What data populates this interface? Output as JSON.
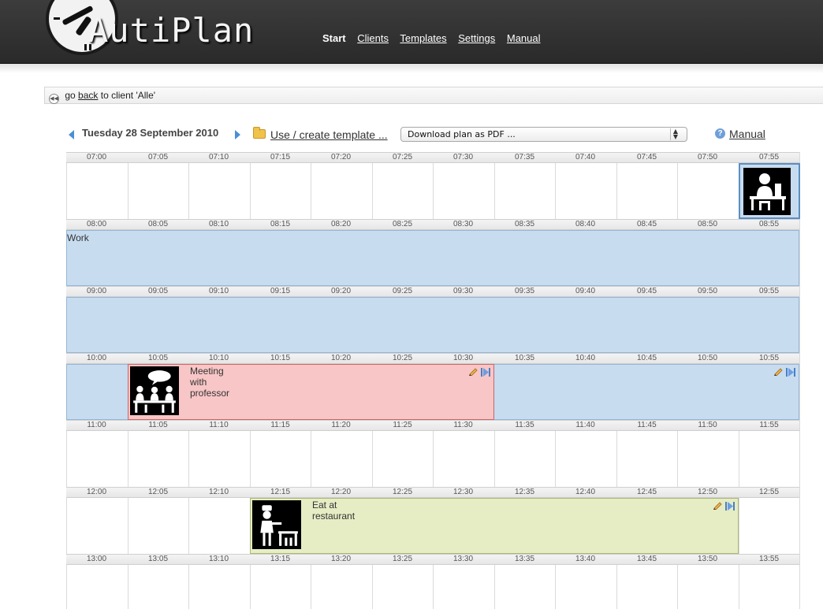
{
  "app": {
    "name": "AutiPlan"
  },
  "nav": {
    "start": "Start",
    "clients": "Clients",
    "templates": "Templates",
    "settings": "Settings",
    "manual": "Manual"
  },
  "back": {
    "prefix": "go",
    "link": "back",
    "suffix": "to client 'Alle'"
  },
  "toolbar": {
    "date": "Tuesday 28 September 2010",
    "template_link": "Use / create template ...",
    "pdf_select": "Download plan as PDF ...",
    "manual_link": "Manual"
  },
  "timeline": {
    "rows": [
      {
        "hour": "07",
        "times": [
          "07:00",
          "07:05",
          "07:10",
          "07:15",
          "07:20",
          "07:25",
          "07:30",
          "07:35",
          "07:40",
          "07:45",
          "07:50",
          "07:55"
        ]
      },
      {
        "hour": "08",
        "times": [
          "08:00",
          "08:05",
          "08:10",
          "08:15",
          "08:20",
          "08:25",
          "08:30",
          "08:35",
          "08:40",
          "08:45",
          "08:50",
          "08:55"
        ]
      },
      {
        "hour": "09",
        "times": [
          "09:00",
          "09:05",
          "09:10",
          "09:15",
          "09:20",
          "09:25",
          "09:30",
          "09:35",
          "09:40",
          "09:45",
          "09:50",
          "09:55"
        ]
      },
      {
        "hour": "10",
        "times": [
          "10:00",
          "10:05",
          "10:10",
          "10:15",
          "10:20",
          "10:25",
          "10:30",
          "10:35",
          "10:40",
          "10:45",
          "10:50",
          "10:55"
        ]
      },
      {
        "hour": "11",
        "times": [
          "11:00",
          "11:05",
          "11:10",
          "11:15",
          "11:20",
          "11:25",
          "11:30",
          "11:35",
          "11:40",
          "11:45",
          "11:50",
          "11:55"
        ]
      },
      {
        "hour": "12",
        "times": [
          "12:00",
          "12:05",
          "12:10",
          "12:15",
          "12:20",
          "12:25",
          "12:30",
          "12:35",
          "12:40",
          "12:45",
          "12:50",
          "12:55"
        ]
      },
      {
        "hour": "13",
        "times": [
          "13:00",
          "13:05",
          "13:10",
          "13:15",
          "13:20",
          "13:25",
          "13:30",
          "13:35",
          "13:40",
          "13:45",
          "13:50",
          "13:55"
        ]
      }
    ]
  },
  "events": {
    "work": {
      "title": "Work",
      "color": "#c8dcf0"
    },
    "meeting": {
      "title_lines": [
        "Meeting",
        "with",
        "professor"
      ],
      "color": "#f8c6c6"
    },
    "restaurant": {
      "title_lines": [
        "Eat at",
        "restaurant"
      ],
      "color": "#e6ecc4"
    },
    "desk_icon": "person-at-desk-icon"
  }
}
